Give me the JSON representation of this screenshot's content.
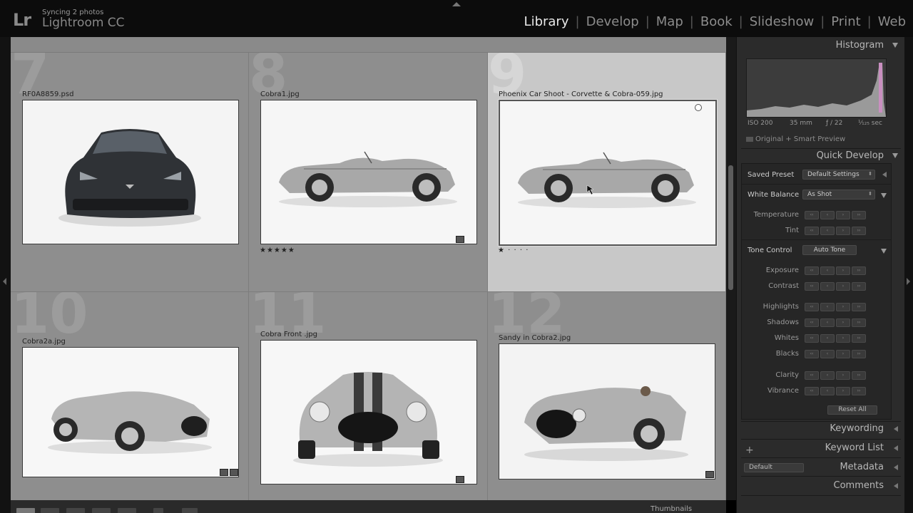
{
  "app": {
    "logo": "Lr",
    "sync_status": "Syncing 2 photos",
    "name": "Lightroom CC"
  },
  "modules": [
    {
      "label": "Library",
      "active": true
    },
    {
      "label": "Develop",
      "active": false
    },
    {
      "label": "Map",
      "active": false
    },
    {
      "label": "Book",
      "active": false
    },
    {
      "label": "Slideshow",
      "active": false
    },
    {
      "label": "Print",
      "active": false
    },
    {
      "label": "Web",
      "active": false
    }
  ],
  "grid": {
    "cells": [
      {
        "num": "7",
        "filename": "RF0A8859.psd",
        "stars": "",
        "selected": false,
        "subject": "corvette-front"
      },
      {
        "num": "8",
        "filename": "Cobra1.jpg",
        "stars": "★★★★★",
        "selected": false,
        "subject": "cobra-side"
      },
      {
        "num": "9",
        "filename": "Phoenix Car Shoot - Corvette & Cobra-059.jpg",
        "stars": "★ · · · ·",
        "selected": true,
        "subject": "cobra-side"
      },
      {
        "num": "10",
        "filename": "Cobra2a.jpg",
        "stars": "",
        "selected": false,
        "subject": "cobra-three-quarter"
      },
      {
        "num": "11",
        "filename": "Cobra Front .jpg",
        "stars": "",
        "selected": false,
        "subject": "cobra-front"
      },
      {
        "num": "12",
        "filename": "Sandy in Cobra2.jpg",
        "stars": "",
        "selected": false,
        "subject": "cobra-driver"
      }
    ]
  },
  "toolbar": {
    "thumbnails_label": "Thumbnails"
  },
  "right_panel": {
    "histogram": {
      "title": "Histogram",
      "iso": "ISO 200",
      "focal": "35 mm",
      "aperture": "ƒ / 22",
      "shutter": "¹⁄₁₂₅ sec",
      "preview_label": "Original + Smart Preview"
    },
    "quick_develop": {
      "title": "Quick Develop",
      "saved_preset_label": "Saved Preset",
      "saved_preset_value": "Default Settings",
      "white_balance_label": "White Balance",
      "white_balance_value": "As Shot",
      "temperature": "Temperature",
      "tint": "Tint",
      "tone_control_label": "Tone Control",
      "auto_tone": "Auto Tone",
      "exposure": "Exposure",
      "contrast": "Contrast",
      "highlights": "Highlights",
      "shadows": "Shadows",
      "whites": "Whites",
      "blacks": "Blacks",
      "clarity": "Clarity",
      "vibrance": "Vibrance",
      "reset_all": "Reset All"
    },
    "keywording": "Keywording",
    "keyword_list": "Keyword List",
    "metadata": "Metadata",
    "metadata_preset": "Default",
    "comments": "Comments"
  }
}
